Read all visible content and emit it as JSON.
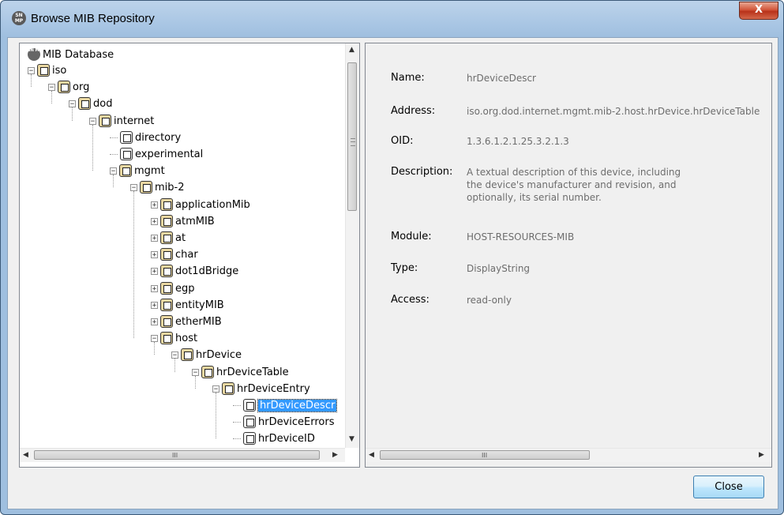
{
  "window": {
    "title": "Browse MIB Repository",
    "app_icon_text": "SN MP",
    "close_glyph": "X"
  },
  "tree": {
    "root": {
      "label": "MIB Database",
      "icon_text": "SN MP"
    },
    "nodes": [
      {
        "label": "iso",
        "depth": 0,
        "state": "expanded"
      },
      {
        "label": "org",
        "depth": 1,
        "state": "expanded"
      },
      {
        "label": "dod",
        "depth": 2,
        "state": "expanded"
      },
      {
        "label": "internet",
        "depth": 3,
        "state": "expanded"
      },
      {
        "label": "directory",
        "depth": 4,
        "state": "leaf"
      },
      {
        "label": "experimental",
        "depth": 4,
        "state": "leaf"
      },
      {
        "label": "mgmt",
        "depth": 4,
        "state": "expanded"
      },
      {
        "label": "mib-2",
        "depth": 5,
        "state": "expanded"
      },
      {
        "label": "applicationMib",
        "depth": 6,
        "state": "collapsed"
      },
      {
        "label": "atmMIB",
        "depth": 6,
        "state": "collapsed"
      },
      {
        "label": "at",
        "depth": 6,
        "state": "collapsed"
      },
      {
        "label": "char",
        "depth": 6,
        "state": "collapsed"
      },
      {
        "label": "dot1dBridge",
        "depth": 6,
        "state": "collapsed"
      },
      {
        "label": "egp",
        "depth": 6,
        "state": "collapsed"
      },
      {
        "label": "entityMIB",
        "depth": 6,
        "state": "collapsed"
      },
      {
        "label": "etherMIB",
        "depth": 6,
        "state": "collapsed"
      },
      {
        "label": "host",
        "depth": 6,
        "state": "expanded"
      },
      {
        "label": "hrDevice",
        "depth": 7,
        "state": "expanded"
      },
      {
        "label": "hrDeviceTable",
        "depth": 8,
        "state": "expanded"
      },
      {
        "label": "hrDeviceEntry",
        "depth": 9,
        "state": "expanded"
      },
      {
        "label": "hrDeviceDescr",
        "depth": 10,
        "state": "leaf",
        "selected": true
      },
      {
        "label": "hrDeviceErrors",
        "depth": 10,
        "state": "leaf"
      },
      {
        "label": "hrDeviceID",
        "depth": 10,
        "state": "leaf"
      }
    ],
    "h_scroll_grip": "III"
  },
  "details": {
    "name_label": "Name:",
    "name_value": "hrDeviceDescr",
    "address_label": "Address:",
    "address_value": "iso.org.dod.internet.mgmt.mib-2.host.hrDevice.hrDeviceTable",
    "oid_label": "OID:",
    "oid_value": "1.3.6.1.2.1.25.3.2.1.3",
    "description_label": "Description:",
    "description_lines": [
      "A textual description of this device, including",
      "the device's manufacturer and revision, and",
      "optionally, its serial number."
    ],
    "module_label": "Module:",
    "module_value": "HOST-RESOURCES-MIB",
    "type_label": "Type:",
    "type_value": "DisplayString",
    "access_label": "Access:",
    "access_value": "read-only",
    "h_scroll_grip": "III"
  },
  "footer": {
    "close_label": "Close"
  },
  "colors": {
    "selection": "#3399ff",
    "value_text": "#6d6d6d",
    "title_gradient": "#a9c6e4"
  }
}
